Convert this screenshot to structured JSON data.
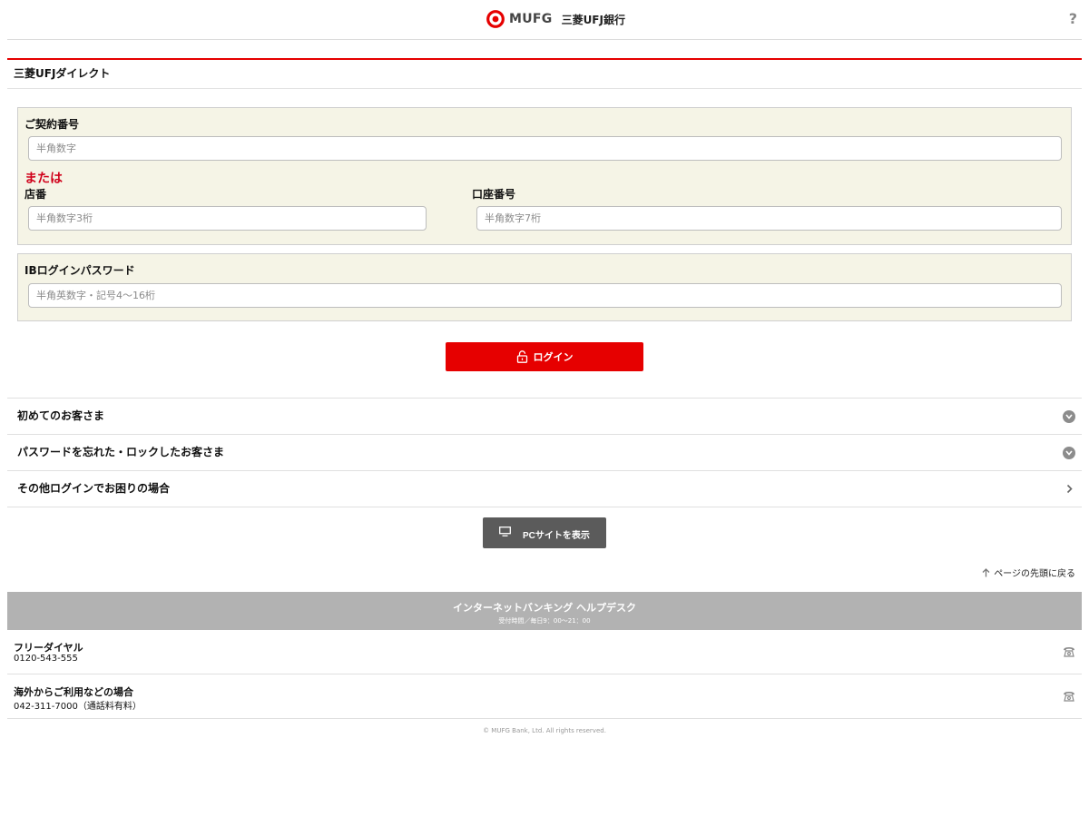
{
  "header": {
    "brand": "MUFG",
    "bank_name": "三菱UFJ銀行",
    "help": "?"
  },
  "section": {
    "title": "三菱UFJダイレクト"
  },
  "form": {
    "contract": {
      "label": "ご契約番号",
      "placeholder": "半角数字"
    },
    "or_label": "または",
    "branch": {
      "label": "店番",
      "placeholder": "半角数字3桁"
    },
    "account": {
      "label": "口座番号",
      "placeholder": "半角数字7桁"
    },
    "password": {
      "label": "IBログインパスワード",
      "placeholder": "半角英数字・記号4～16桁"
    },
    "login_label": "ログイン"
  },
  "list": [
    {
      "label": "初めてのお客さま",
      "icon": "chevron-down-circle-icon"
    },
    {
      "label": "パスワードを忘れた・ロックしたお客さま",
      "icon": "chevron-down-circle-icon"
    },
    {
      "label": "その他ログインでお困りの場合",
      "icon": "chevron-right-icon"
    }
  ],
  "pc_site_label": "PCサイトを表示",
  "to_top_label": "ページの先頭に戻る",
  "helpdesk": {
    "title": "インターネットバンキング ヘルプデスク",
    "hours": "受付時間／毎日9：00～21：00"
  },
  "contacts": [
    {
      "title": "フリーダイヤル",
      "number": "0120-543-555"
    },
    {
      "title": "海外からご利用などの場合",
      "number": "042-311-7000（通話料有料）"
    }
  ],
  "copyright": "© MUFG Bank, Ltd. All rights reserved.",
  "colors": {
    "accent_red": "#e60000",
    "form_bg": "#f5f4e6",
    "helpdesk_bg": "#b2b2b2",
    "pc_button": "#5b5b5b"
  }
}
